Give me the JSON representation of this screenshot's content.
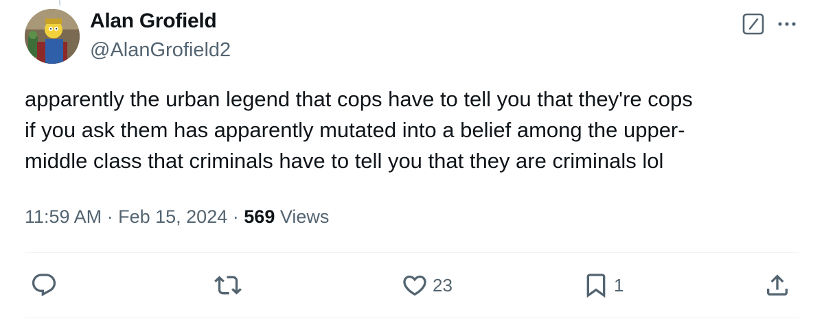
{
  "author": {
    "display_name": "Alan Grofield",
    "handle": "@AlanGrofield2",
    "avatar_icon": "cartoon-character-avatar"
  },
  "tweet": {
    "text": "apparently the urban legend that cops have to tell you that they're cops\nif you ask them has apparently mutated into a belief among the upper-\nmiddle class that criminals have to tell you that they are criminals lol",
    "time": "11:59 AM",
    "separator": "·",
    "date": "Feb 15, 2024",
    "views_count": "569",
    "views_label": "Views"
  },
  "actions": {
    "reply_icon": "reply-icon",
    "retweet_icon": "retweet-icon",
    "like_icon": "heart-icon",
    "like_count": "23",
    "bookmark_icon": "bookmark-icon",
    "bookmark_count": "1",
    "share_icon": "share-icon"
  },
  "colors": {
    "text": "#0f1419",
    "secondary": "#536471",
    "divider": "#eff3f4"
  }
}
